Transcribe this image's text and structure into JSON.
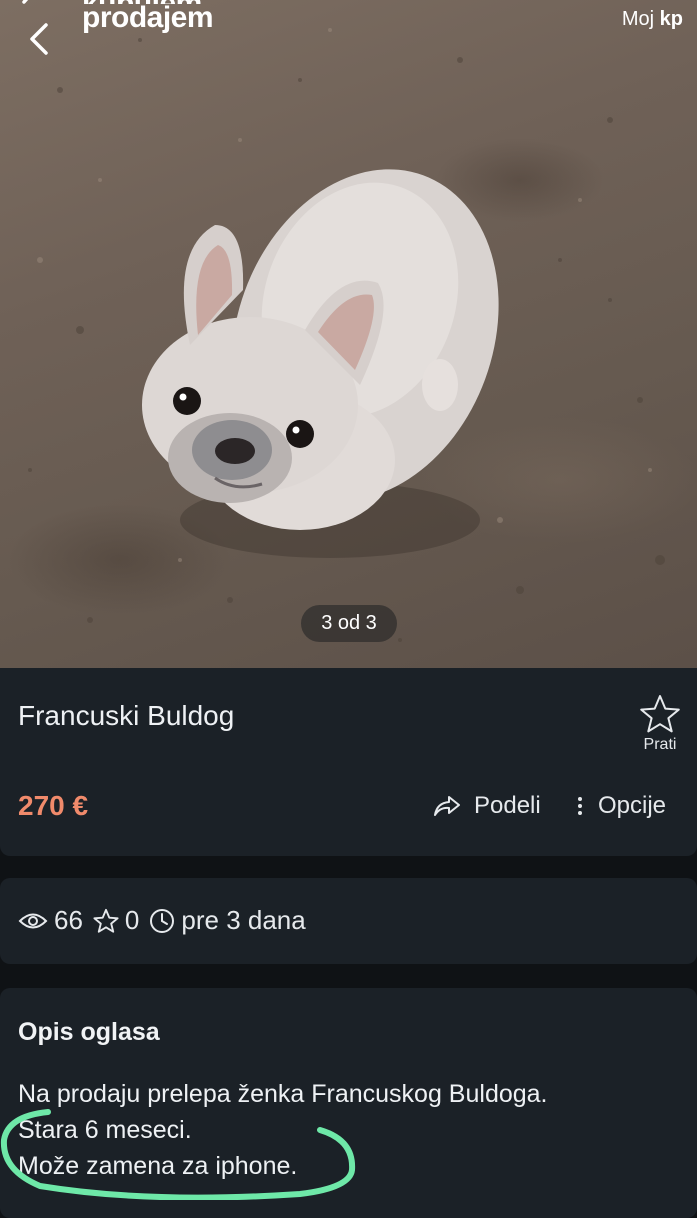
{
  "header": {
    "logo_line1": "kupujem",
    "logo_line2": "prodajem",
    "my_kp_prefix": "Moj",
    "my_kp_bold": "kp",
    "icons": {
      "back": "chevron-left-icon"
    }
  },
  "gallery": {
    "counter": "3 od 3"
  },
  "listing": {
    "title": "Francuski Buldog",
    "price": "270 €",
    "follow_label": "Prati",
    "share_label": "Podeli",
    "options_label": "Opcije",
    "icons": {
      "follow": "star-outline-icon",
      "share": "share-arrow-icon",
      "options": "vertical-dots-icon"
    }
  },
  "stats": {
    "views": "66",
    "favorites": "0",
    "age": "pre 3 dana",
    "icons": {
      "views": "eye-icon",
      "favorites": "star-outline-icon",
      "age": "clock-icon"
    }
  },
  "description": {
    "heading": "Opis oglasa",
    "lines": [
      "Na prodaju prelepa ženka Francuskog Buldoga.",
      "Stara 6 meseci.",
      "Može zamena za iphone."
    ]
  },
  "colors": {
    "price": "#f08a6b",
    "card": "#1b2127",
    "background": "#0f1215",
    "highlight": "#6ee8a8"
  }
}
